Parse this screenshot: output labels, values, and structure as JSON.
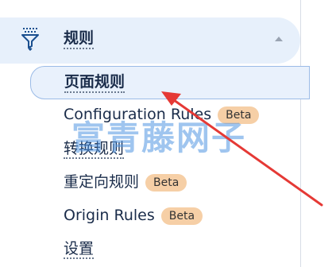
{
  "section": {
    "title": "规则",
    "icon": "filter-funnel-icon",
    "caret_icon": "caret-up-icon"
  },
  "nav": {
    "items": [
      {
        "label": "页面规则",
        "active": true
      },
      {
        "label": "Configuration Rules",
        "badge": "Beta"
      },
      {
        "label": "转换规则"
      },
      {
        "label": "重定向规则",
        "badge": "Beta"
      },
      {
        "label": "Origin Rules",
        "badge": "Beta"
      },
      {
        "label": "设置"
      }
    ]
  },
  "watermark": {
    "text": "富青藤网子"
  },
  "annotation": {
    "arrow_color": "#e53935"
  },
  "colors": {
    "header_bg": "#e7f0fb",
    "active_border": "#9bbbe7",
    "badge_bg": "#f6cfa6",
    "text": "#1a2c4a"
  }
}
